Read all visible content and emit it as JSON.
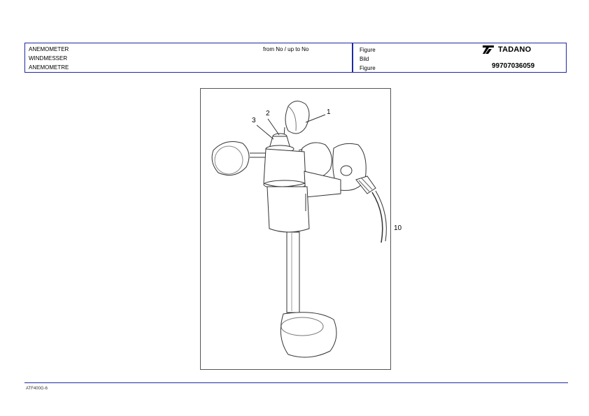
{
  "header": {
    "titles": [
      "ANEMOMETER",
      "WINDMESSER",
      "ANEMOMETRE"
    ],
    "range": "from No / up to No",
    "figure_labels": [
      "Figure",
      "Bild",
      "Figure"
    ],
    "brand": "TADANO",
    "part_number": "99707036059"
  },
  "callouts": {
    "c1": "1",
    "c2": "2",
    "c3": "3",
    "c10": "10"
  },
  "footer": {
    "code": "ATF400G-6"
  },
  "colors": {
    "frame_blue": "#1f2a9e"
  }
}
